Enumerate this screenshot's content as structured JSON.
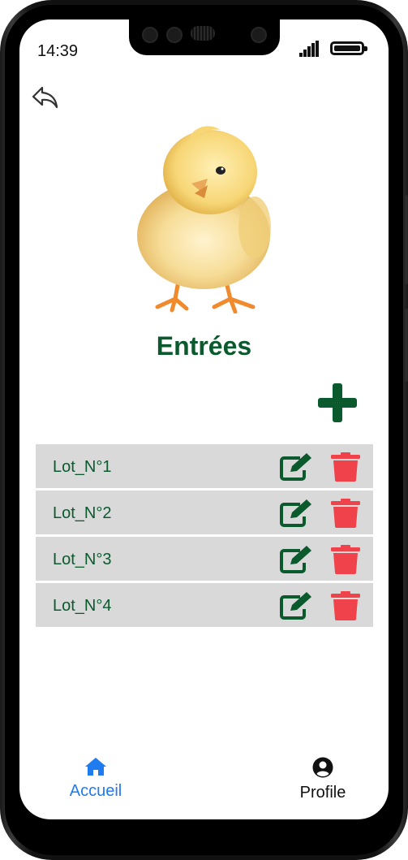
{
  "status_bar": {
    "time": "14:39"
  },
  "page": {
    "title": "Entrées"
  },
  "lots": [
    {
      "label": "Lot_N°1"
    },
    {
      "label": "Lot_N°2"
    },
    {
      "label": "Lot_N°3"
    },
    {
      "label": "Lot_N°4"
    }
  ],
  "bottom_nav": {
    "home_label": "Accueil",
    "profile_label": "Profile"
  },
  "icons": {
    "back": "reply-arrow-icon",
    "add": "plus-icon",
    "edit": "edit-pencil-icon",
    "delete": "trash-icon",
    "home": "home-icon",
    "profile": "user-circle-icon"
  },
  "colors": {
    "title_green": "#0b5a2e",
    "row_bg": "#d9d9d9",
    "delete_red": "#f0424b",
    "active_nav_blue": "#1e7bf0",
    "inactive_nav": "#111111"
  }
}
